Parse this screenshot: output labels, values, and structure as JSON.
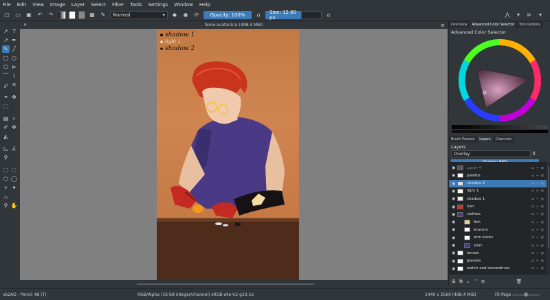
{
  "menubar": [
    "File",
    "Edit",
    "View",
    "Image",
    "Layer",
    "Select",
    "Filter",
    "Tools",
    "Settings",
    "Window",
    "Help"
  ],
  "toolbar": {
    "blend_mode": "Normal",
    "opacity_label": "Opacity: 100%",
    "size_label": "Size: 12.00 px"
  },
  "document": {
    "tab_title": "ferox-avatar.kra (498.4 MiB)"
  },
  "artwork": {
    "notes": [
      "shadow 1",
      "light 1",
      "shadow 2"
    ]
  },
  "dock": {
    "top_tabs": [
      "Overview",
      "Advanced Color Selector",
      "Tool Options"
    ],
    "color_title": "Advanced Color Selector",
    "mid_tabs": [
      "Brush Presets",
      "Layers",
      "Channels"
    ],
    "layers_title": "Layers",
    "blend_mode": "Overlay",
    "opacity_label": "Opacity: 64%"
  },
  "layers": [
    {
      "name": "Layer 4",
      "selected": false,
      "indent": 0,
      "thumb": "#555555",
      "dim": true
    },
    {
      "name": "palette",
      "selected": false,
      "indent": 0,
      "thumb": "#ffffff"
    },
    {
      "name": "shadow 2",
      "selected": true,
      "indent": 0,
      "thumb": "#dddddd"
    },
    {
      "name": "light 1",
      "selected": false,
      "indent": 0,
      "thumb": "#ffffff"
    },
    {
      "name": "shadow 1",
      "selected": false,
      "indent": 0,
      "thumb": "#eeeeee"
    },
    {
      "name": "hair",
      "selected": false,
      "indent": 0,
      "thumb": "#c0392b"
    },
    {
      "name": "clothes",
      "selected": false,
      "indent": 0,
      "thumb": "#4b3a8a"
    },
    {
      "name": "fish",
      "selected": false,
      "indent": 1,
      "thumb": "#e8d39a"
    },
    {
      "name": "bracers",
      "selected": false,
      "indent": 1,
      "thumb": "#ffffff"
    },
    {
      "name": "arm socks",
      "selected": false,
      "indent": 1,
      "thumb": "#ffffff"
    },
    {
      "name": "shirt",
      "selected": false,
      "indent": 1,
      "thumb": "#4b3a8a"
    },
    {
      "name": "lenses",
      "selected": false,
      "indent": 0,
      "thumb": "#ffffff"
    },
    {
      "name": "glasses",
      "selected": false,
      "indent": 0,
      "thumb": "#ffffff"
    },
    {
      "name": "watch and screwdriver",
      "selected": false,
      "indent": 0,
      "thumb": "#ffffff"
    }
  ],
  "statusbar": {
    "brush": "vb2AD - Pencil 4B (T)",
    "colorspace": "RGB/Alpha (16-bit integer/channel)  sRGB-elle-V2-g10.icc",
    "dimensions": "1440 x 2560 (498.4 MiB)",
    "zoom_mode": "Fit Page"
  }
}
